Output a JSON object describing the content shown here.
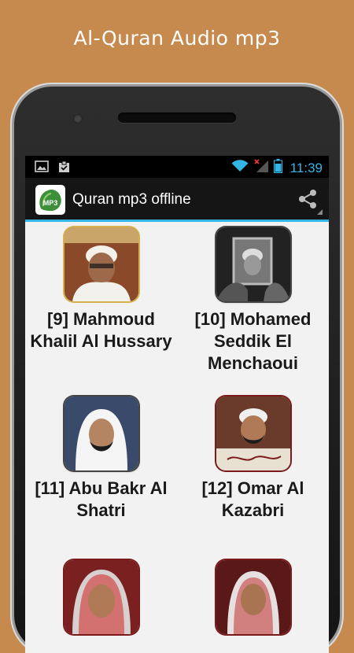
{
  "promo": {
    "title": "Al-Quran Audio mp3"
  },
  "status_bar": {
    "time": "11:39"
  },
  "action_bar": {
    "title": "Quran mp3 offline",
    "share_icon": "share-icon"
  },
  "reciters": [
    {
      "label": "[9] Mahmoud Khalil Al Hussary"
    },
    {
      "label": "[10] Mohamed Seddik El Menchaoui"
    },
    {
      "label": "[11] Abu Bakr Al Shatri"
    },
    {
      "label": "[12] Omar Al Kazabri"
    },
    {
      "label": ""
    },
    {
      "label": ""
    }
  ],
  "colors": {
    "accent": "#33b5e5",
    "background": "#c78a4e",
    "action_bar": "#151515"
  }
}
